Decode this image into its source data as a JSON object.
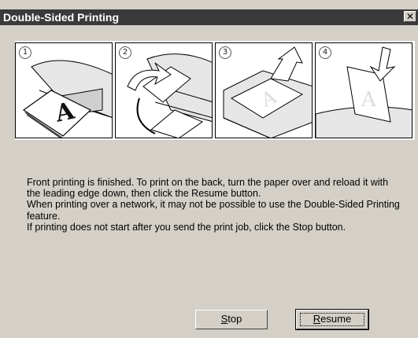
{
  "window": {
    "title": "Double-Sided Printing",
    "close_glyph": "✕"
  },
  "steps": [
    {
      "number": "1",
      "icon": "printer-output-paper-icon"
    },
    {
      "number": "2",
      "icon": "flip-paper-icon"
    },
    {
      "number": "3",
      "icon": "reload-paper-icon"
    },
    {
      "number": "4",
      "icon": "feed-paper-icon"
    }
  ],
  "message": {
    "line1": "Front printing is finished. To print on the back, turn the paper over and reload it with the leading edge down, then click the Resume button.",
    "line2": "When printing over a network, it may not be possible to use the Double-Sided Printing feature.",
    "line3": "If printing does not start after you send the print job, click the Stop button."
  },
  "buttons": {
    "stop_first": "S",
    "stop_rest": "top",
    "resume_first": "R",
    "resume_rest": "esume"
  }
}
